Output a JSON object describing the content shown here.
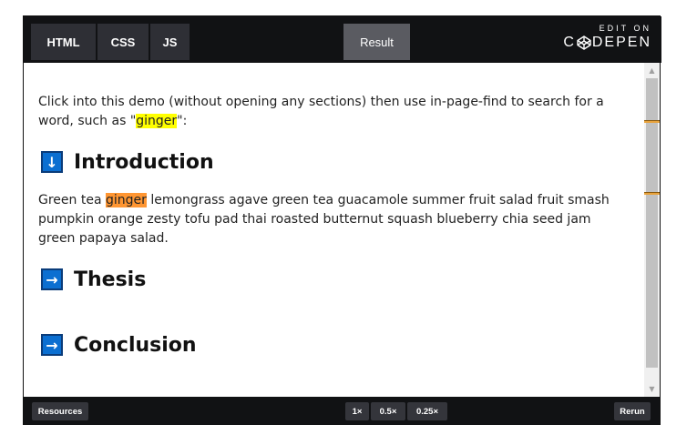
{
  "header": {
    "tabs": [
      {
        "label": "HTML"
      },
      {
        "label": "CSS"
      },
      {
        "label": "JS"
      }
    ],
    "result_tab": "Result",
    "brand_top": "EDIT ON",
    "brand_word_prefix": "C",
    "brand_word_suffix": "DEPEN"
  },
  "content": {
    "intro_text_before": "Click into this demo (without opening any sections) then use in-page-find to search for a word, such as \"",
    "intro_highlight": "ginger",
    "intro_text_after": "\":",
    "sections": [
      {
        "title": "Introduction",
        "arrow": "↓",
        "body_before": "Green tea ",
        "body_highlight": "ginger",
        "body_after": " lemongrass agave green tea guacamole summer fruit salad fruit smash pumpkin orange zesty tofu pad thai roasted butternut squash blueberry chia seed jam green papaya salad."
      },
      {
        "title": "Thesis",
        "arrow": "→"
      },
      {
        "title": "Conclusion",
        "arrow": "→"
      }
    ]
  },
  "scrollbar": {
    "up_arrow": "▲",
    "down_arrow": "▼"
  },
  "footer": {
    "resources": "Resources",
    "zoom_1x": "1×",
    "zoom_05x": "0.5×",
    "zoom_025x": "0.25×",
    "rerun": "Rerun"
  },
  "colors": {
    "find_current_match": "#ff9632",
    "find_other_match": "#ffff00",
    "section_arrow_bg": "#0b6fd1"
  }
}
